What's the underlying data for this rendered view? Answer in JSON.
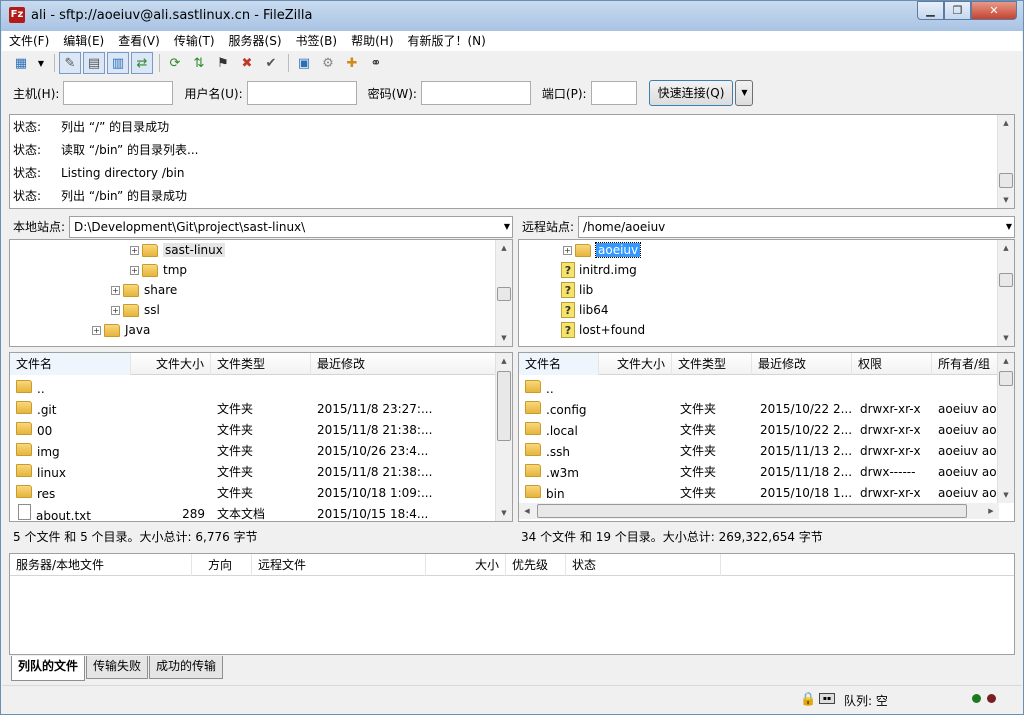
{
  "window": {
    "title": "ali - sftp://aoeiuv@ali.sastlinux.cn - FileZilla"
  },
  "menu": [
    "文件(F)",
    "编辑(E)",
    "查看(V)",
    "传输(T)",
    "服务器(S)",
    "书签(B)",
    "帮助(H)",
    "有新版了！(N)"
  ],
  "quickconnect": {
    "host_label": "主机(H):",
    "user_label": "用户名(U):",
    "pass_label": "密码(W):",
    "port_label": "端口(P):",
    "connect_label": "快速连接(Q)"
  },
  "log": [
    {
      "k": "状态:",
      "v": "列出 “/” 的目录成功"
    },
    {
      "k": "状态:",
      "v": "读取 “/bin” 的目录列表..."
    },
    {
      "k": "状态:",
      "v": "Listing directory /bin"
    },
    {
      "k": "状态:",
      "v": "列出 “/bin” 的目录成功"
    }
  ],
  "local": {
    "site_label": "本地站点:",
    "path": "D:\\Development\\Git\\project\\sast-linux\\",
    "tree": [
      "sast-linux",
      "tmp",
      "share",
      "ssl",
      "Java"
    ],
    "headers": [
      "文件名",
      "文件大小",
      "文件类型",
      "最近修改"
    ],
    "files": [
      {
        "name": "..",
        "size": "",
        "type": "",
        "mod": ""
      },
      {
        "name": ".git",
        "size": "",
        "type": "文件夹",
        "mod": "2015/11/8 23:27:..."
      },
      {
        "name": "00",
        "size": "",
        "type": "文件夹",
        "mod": "2015/11/8 21:38:..."
      },
      {
        "name": "img",
        "size": "",
        "type": "文件夹",
        "mod": "2015/10/26 23:4..."
      },
      {
        "name": "linux",
        "size": "",
        "type": "文件夹",
        "mod": "2015/11/8 21:38:..."
      },
      {
        "name": "res",
        "size": "",
        "type": "文件夹",
        "mod": "2015/10/18 1:09:..."
      },
      {
        "name": "about.txt",
        "size": "289",
        "type": "文本文档",
        "mod": "2015/10/15 18:4..."
      }
    ],
    "status": "5 个文件 和 5 个目录。大小总计: 6,776 字节"
  },
  "remote": {
    "site_label": "远程站点:",
    "path": "/home/aoeiuv",
    "tree": [
      "aoeiuv",
      "initrd.img",
      "lib",
      "lib64",
      "lost+found"
    ],
    "headers": [
      "文件名",
      "文件大小",
      "文件类型",
      "最近修改",
      "权限",
      "所有者/组"
    ],
    "files": [
      {
        "name": "..",
        "size": "",
        "type": "",
        "mod": "",
        "perm": "",
        "owner": ""
      },
      {
        "name": ".config",
        "size": "",
        "type": "文件夹",
        "mod": "2015/10/22 2...",
        "perm": "drwxr-xr-x",
        "owner": "aoeiuv ao"
      },
      {
        "name": ".local",
        "size": "",
        "type": "文件夹",
        "mod": "2015/10/22 2...",
        "perm": "drwxr-xr-x",
        "owner": "aoeiuv ao"
      },
      {
        "name": ".ssh",
        "size": "",
        "type": "文件夹",
        "mod": "2015/11/13 2...",
        "perm": "drwxr-xr-x",
        "owner": "aoeiuv ao"
      },
      {
        "name": ".w3m",
        "size": "",
        "type": "文件夹",
        "mod": "2015/11/18 2...",
        "perm": "drwx------",
        "owner": "aoeiuv ao"
      },
      {
        "name": "bin",
        "size": "",
        "type": "文件夹",
        "mod": "2015/10/18 1...",
        "perm": "drwxr-xr-x",
        "owner": "aoeiuv ao"
      }
    ],
    "status": "34 个文件 和 19 个目录。大小总计: 269,322,654 字节"
  },
  "queue": {
    "headers": [
      "服务器/本地文件",
      "方向",
      "远程文件",
      "大小",
      "优先级",
      "状态"
    ],
    "tabs": [
      "列队的文件",
      "传输失败",
      "成功的传输"
    ],
    "status": "队列: 空"
  }
}
